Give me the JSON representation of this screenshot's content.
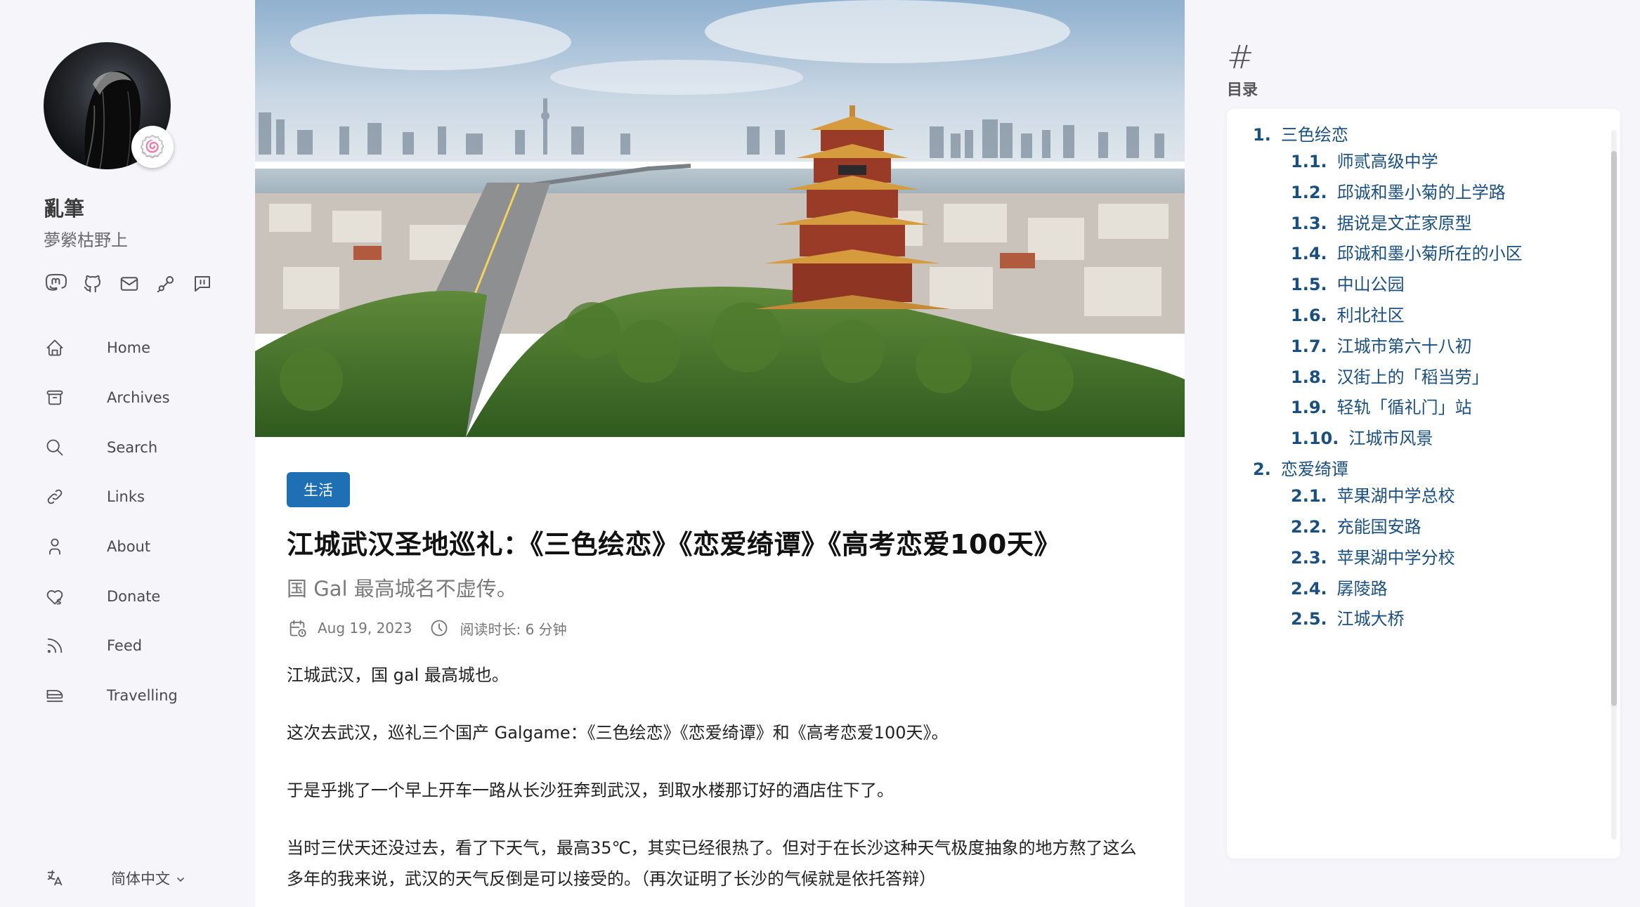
{
  "site": {
    "name": "亂筆",
    "description": "夢縈枯野上",
    "avatar_emoji": "🍥"
  },
  "social_icons": [
    "mastodon-icon",
    "github-icon",
    "mail-icon",
    "steam-icon",
    "message-icon"
  ],
  "nav": [
    {
      "label": "Home",
      "icon": "home-icon"
    },
    {
      "label": "Archives",
      "icon": "archive-icon"
    },
    {
      "label": "Search",
      "icon": "search-icon"
    },
    {
      "label": "Links",
      "icon": "link-icon"
    },
    {
      "label": "About",
      "icon": "user-icon"
    },
    {
      "label": "Donate",
      "icon": "donate-heart-icon"
    },
    {
      "label": "Feed",
      "icon": "rss-icon"
    },
    {
      "label": "Travelling",
      "icon": "train-icon"
    }
  ],
  "language": {
    "label": "简体中文",
    "icon": "translate-icon"
  },
  "article": {
    "category": "生活",
    "title": "江城武汉圣地巡礼：《三色绘恋》《恋爱绮谭》《高考恋爱100天》",
    "subtitle": "国 Gal 最高城名不虚传。",
    "date": "Aug 19, 2023",
    "reading_time": "阅读时长: 6 分钟",
    "paragraphs": [
      "江城武汉，国 gal 最高城也。",
      "这次去武汉，巡礼三个国产 Galgame：《三色绘恋》《恋爱绮谭》和《高考恋爱100天》。",
      "于是乎挑了一个早上开车一路从长沙狂奔到武汉，到取水楼那订好的酒店住下了。",
      "当时三伏天还没过去，看了下天气，最高35℃，其实已经很热了。但对于在长沙这种天气极度抽象的地方熬了这么多年的我来说，武汉的天气反倒是可以接受的。（再次证明了长沙的气候就是依托答辩）"
    ]
  },
  "toc": {
    "hash": "#",
    "title": "目录",
    "items": [
      {
        "num": "1.",
        "text": "三色绘恋",
        "level": 1
      },
      {
        "num": "1.1.",
        "text": "师贰高级中学",
        "level": 2
      },
      {
        "num": "1.2.",
        "text": "邱诚和墨小菊的上学路",
        "level": 2
      },
      {
        "num": "1.3.",
        "text": "据说是文芷家原型",
        "level": 2
      },
      {
        "num": "1.4.",
        "text": "邱诚和墨小菊所在的小区",
        "level": 2
      },
      {
        "num": "1.5.",
        "text": "中山公园",
        "level": 2
      },
      {
        "num": "1.6.",
        "text": "利北社区",
        "level": 2
      },
      {
        "num": "1.7.",
        "text": "江城市第六十八初",
        "level": 2
      },
      {
        "num": "1.8.",
        "text": "汉街上的「稻当劳」",
        "level": 2
      },
      {
        "num": "1.9.",
        "text": "轻轨「循礼门」站",
        "level": 2
      },
      {
        "num": "1.10.",
        "text": "江城市风景",
        "level": 2
      },
      {
        "num": "2.",
        "text": "恋爱绮谭",
        "level": 1
      },
      {
        "num": "2.1.",
        "text": "苹果湖中学总校",
        "level": 2
      },
      {
        "num": "2.2.",
        "text": "充能国安路",
        "level": 2
      },
      {
        "num": "2.3.",
        "text": "苹果湖中学分校",
        "level": 2
      },
      {
        "num": "2.4.",
        "text": "孱陵路",
        "level": 2
      },
      {
        "num": "2.5.",
        "text": "江城大桥",
        "level": 2
      }
    ]
  }
}
